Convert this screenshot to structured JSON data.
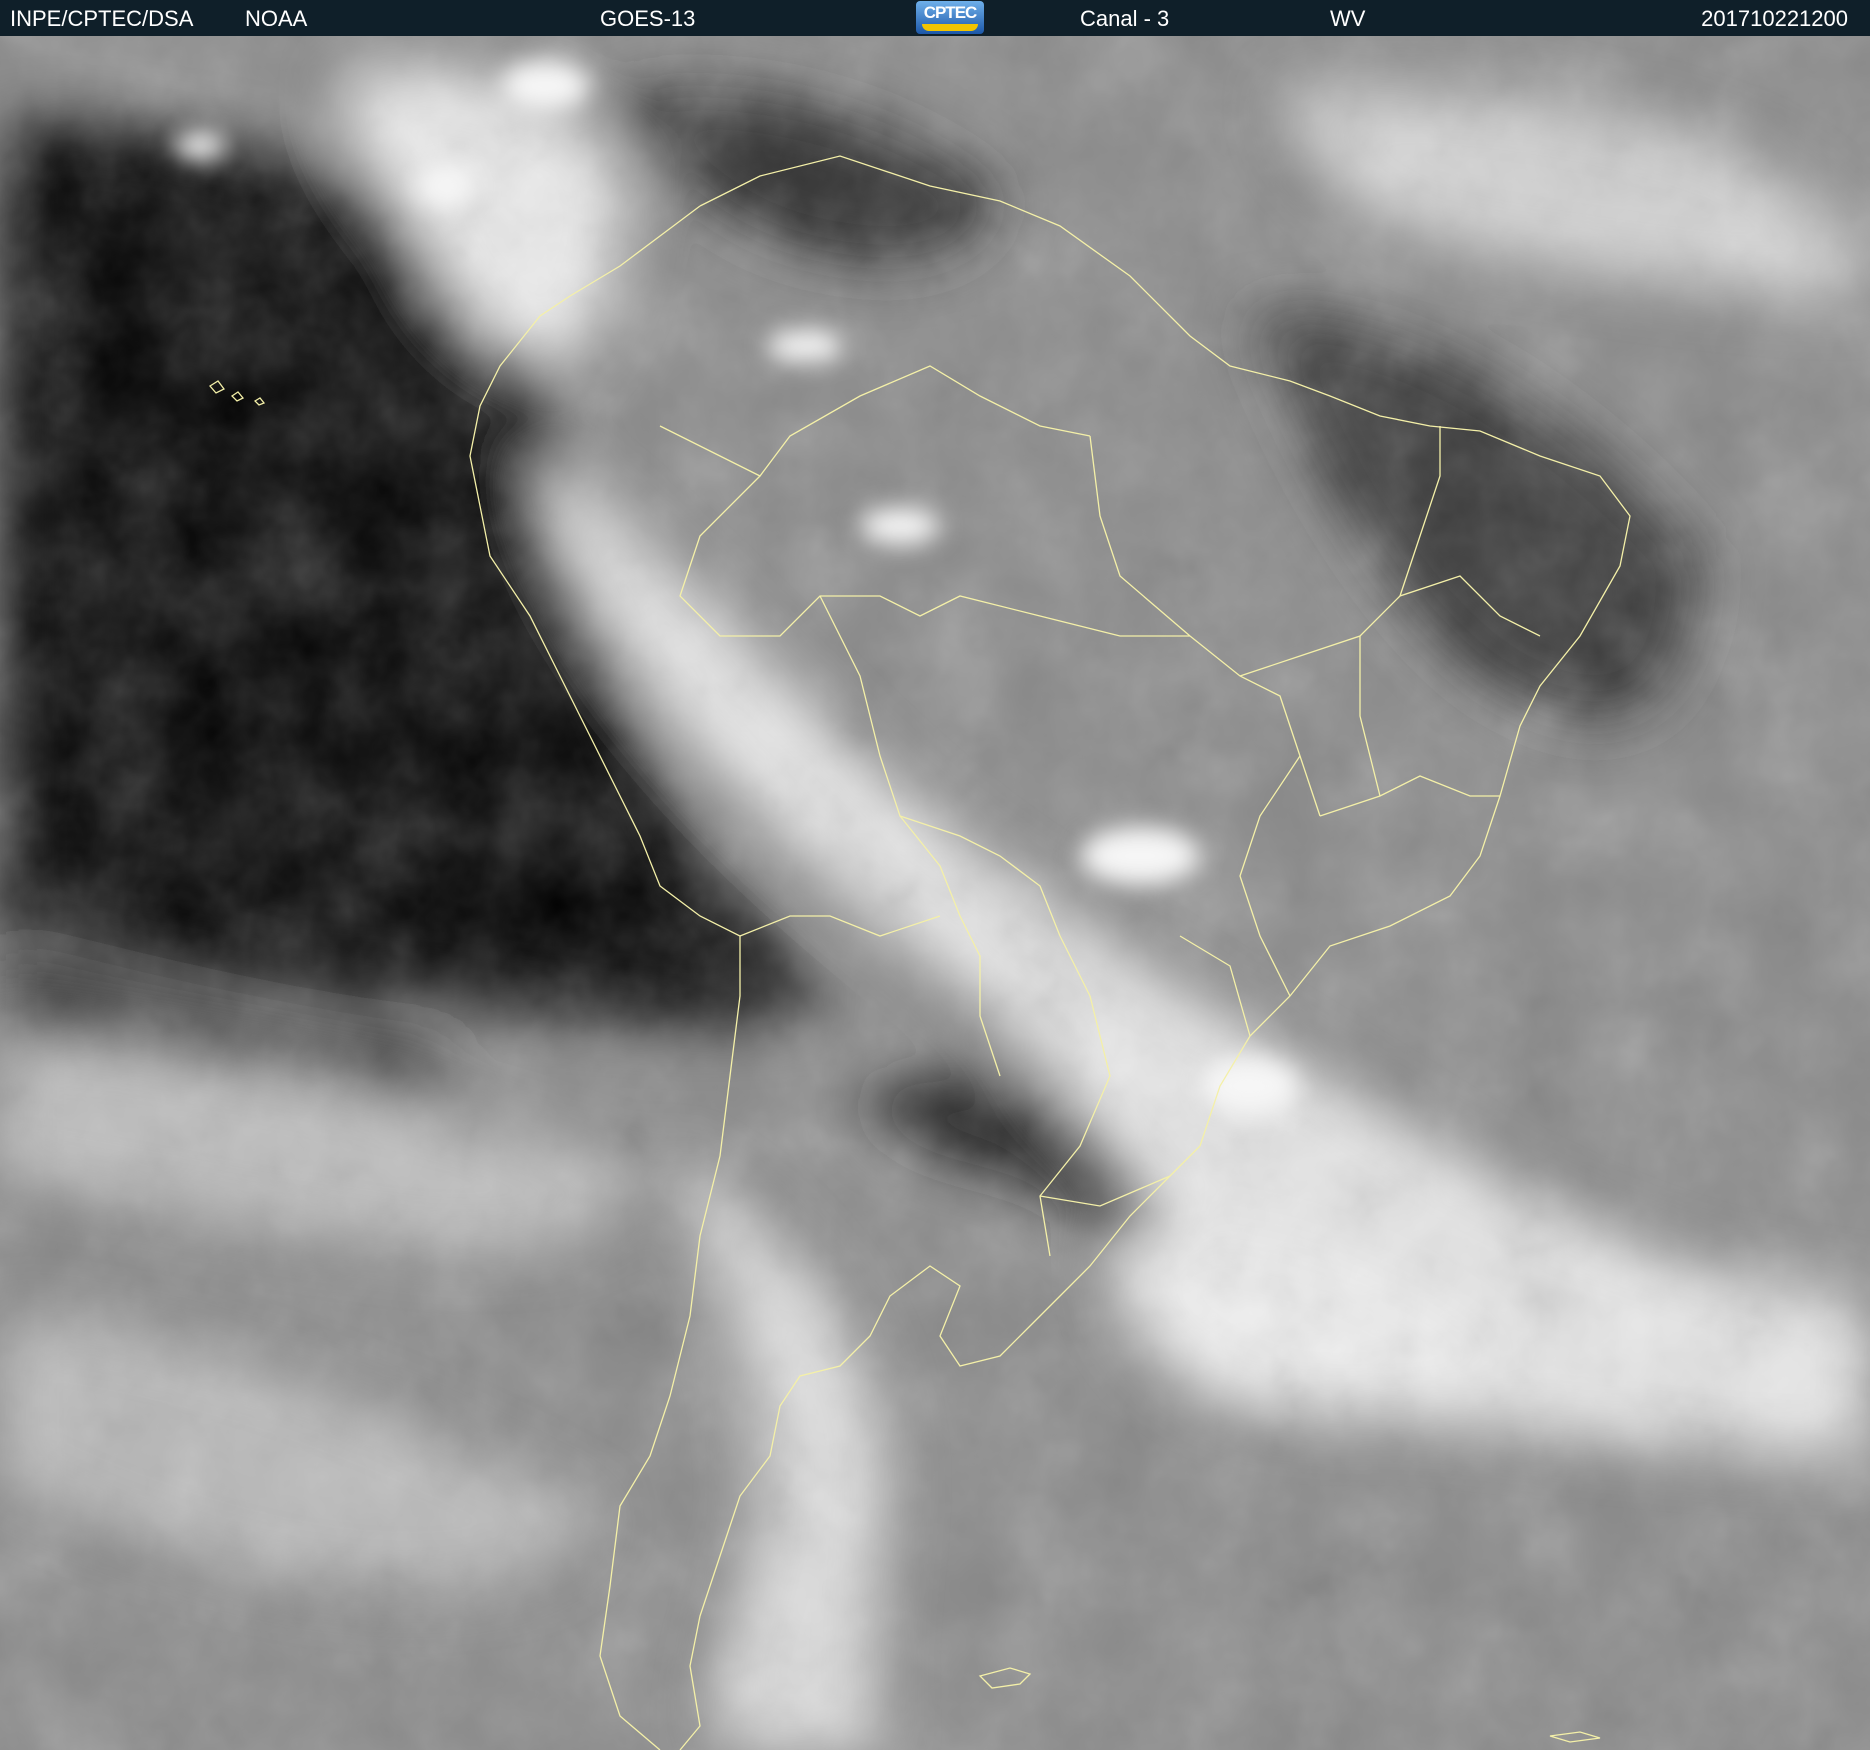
{
  "header": {
    "institution": "INPE/CPTEC/DSA",
    "agency": "NOAA",
    "satellite": "GOES-13",
    "logo_text": "CPTEC",
    "channel": "Canal - 3",
    "band": "WV",
    "timestamp": "201710221200"
  },
  "colors": {
    "header_bg": "#0f1f29",
    "header_text": "#ffffff",
    "coastline": "#f4f0a8",
    "ocean_dry": "#050505",
    "cloud_bright": "#f2f2f2",
    "vapor_mid": "#8a8a8a"
  }
}
